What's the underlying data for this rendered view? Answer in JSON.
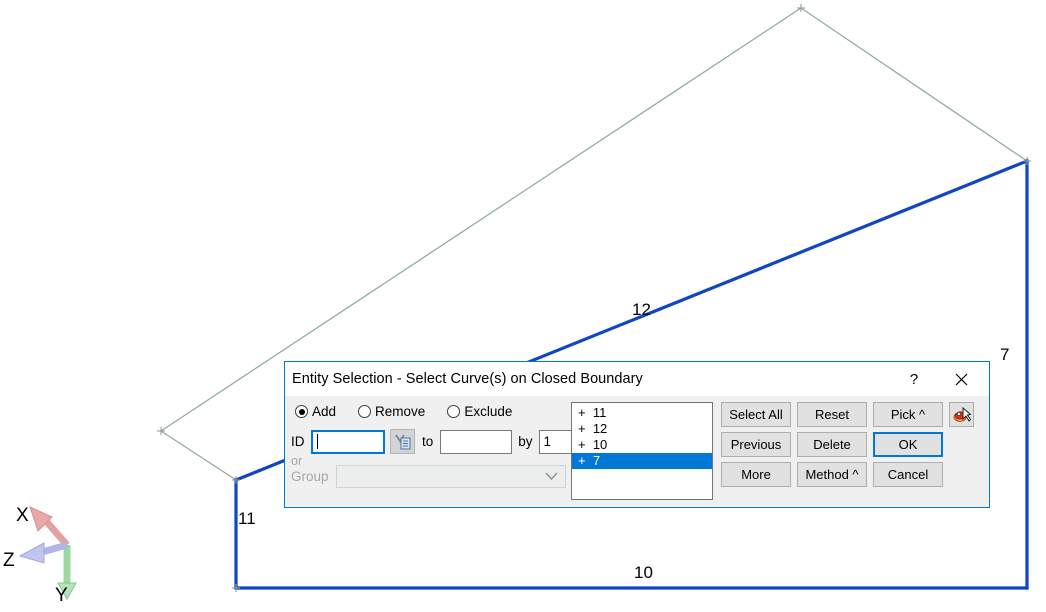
{
  "viewport": {
    "curve_labels": [
      {
        "id": "12",
        "text": "12"
      },
      {
        "id": "7",
        "text": "7"
      },
      {
        "id": "11",
        "text": "11"
      },
      {
        "id": "10",
        "text": "10"
      }
    ],
    "colors": {
      "selected_curve": "#1046c3",
      "unselected_curve": "#8fae99",
      "background": "#ffffff",
      "vertex_marker": "#9a9a9a"
    },
    "triad": {
      "x_label": "X",
      "y_label": "Y",
      "z_label": "Z",
      "x_color": "#e08b8b",
      "y_color": "#9cd9a0",
      "z_color": "#a8aee4"
    }
  },
  "dialog": {
    "title": "Entity Selection - Select Curve(s) on Closed Boundary",
    "help_label": "?",
    "close_label": "✕",
    "accent_color": "#0078d7",
    "body_color": "#f0f0f0",
    "modes": [
      {
        "label": "Add",
        "selected": true
      },
      {
        "label": "Remove",
        "selected": false
      },
      {
        "label": "Exclude",
        "selected": false
      }
    ],
    "fields": {
      "id_label": "ID",
      "id_value": "",
      "id_placeholder": "",
      "to_label": "to",
      "to_value": "",
      "to_placeholder": "",
      "by_label": "by",
      "by_value": "1",
      "or_label": "or",
      "group_label": "Group",
      "group_value": "",
      "group_placeholder": ""
    },
    "entity_list": [
      {
        "text": "+  11",
        "selected": false
      },
      {
        "text": "+  12",
        "selected": false
      },
      {
        "text": "+  10",
        "selected": false
      },
      {
        "text": "+  7",
        "selected": true
      }
    ],
    "buttons": [
      {
        "label": "Select All",
        "default": false
      },
      {
        "label": "Reset",
        "default": false
      },
      {
        "label": "Pick ^",
        "default": false
      },
      {
        "label": "Previous",
        "default": false
      },
      {
        "label": "Delete",
        "default": false
      },
      {
        "label": "OK",
        "default": true
      },
      {
        "label": "More",
        "default": false
      },
      {
        "label": "Method ^",
        "default": false
      },
      {
        "label": "Cancel",
        "default": false
      }
    ]
  }
}
